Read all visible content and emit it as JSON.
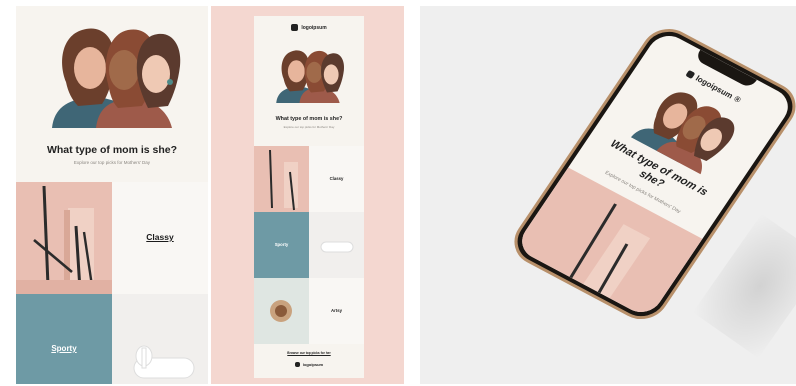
{
  "brand": {
    "logo_text": "logoipsum",
    "trademark": "®"
  },
  "email": {
    "headline": "What type of mom is she?",
    "subhead": "Explore our top picks for Mothers' Day",
    "categories": [
      {
        "label": "Classy"
      },
      {
        "label": "Sporty"
      },
      {
        "label": "Artsy"
      }
    ],
    "browse_link": "Browse our top picks for her"
  },
  "colors": {
    "background_cream": "#f7f4ef",
    "blush": "#f4d7d0",
    "pink_tile": "#e9bfb3",
    "teal_tile": "#6e9aa5",
    "phone_gold": "#b8906a"
  }
}
